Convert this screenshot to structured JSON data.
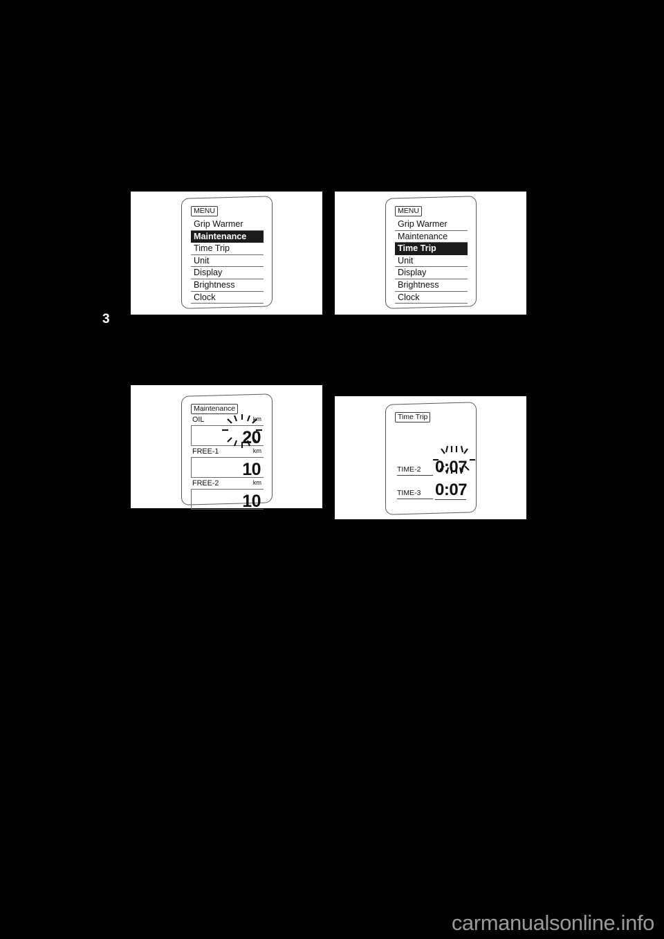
{
  "page": {
    "chapter_marker": "3",
    "background_color": "#000000",
    "plate_color": "#ffffff",
    "watermark": "carmanualsonline.info",
    "watermark_color": "#9a9a9a"
  },
  "figures": [
    {
      "id": "menu-maintenance",
      "screen_title": "MENU",
      "type": "menu",
      "items": [
        {
          "label": "Grip Warmer",
          "selected": false
        },
        {
          "label": "Maintenance",
          "selected": true
        },
        {
          "label": "Time Trip",
          "selected": false
        },
        {
          "label": "Unit",
          "selected": false
        },
        {
          "label": "Display",
          "selected": false
        },
        {
          "label": "Brightness",
          "selected": false
        },
        {
          "label": "Clock",
          "selected": false
        }
      ]
    },
    {
      "id": "menu-timetrip",
      "screen_title": "MENU",
      "type": "menu",
      "items": [
        {
          "label": "Grip Warmer",
          "selected": false
        },
        {
          "label": "Maintenance",
          "selected": false
        },
        {
          "label": "Time Trip",
          "selected": true
        },
        {
          "label": "Unit",
          "selected": false
        },
        {
          "label": "Display",
          "selected": false
        },
        {
          "label": "Brightness",
          "selected": false
        },
        {
          "label": "Clock",
          "selected": false
        }
      ]
    },
    {
      "id": "maintenance-screen",
      "screen_title": "Maintenance",
      "type": "values",
      "rows": [
        {
          "label": "OIL",
          "unit": "km",
          "value": "20",
          "flashing": true
        },
        {
          "label": "FREE-1",
          "unit": "km",
          "value": "10",
          "flashing": false
        },
        {
          "label": "FREE-2",
          "unit": "km",
          "value": "10",
          "flashing": false
        }
      ]
    },
    {
      "id": "timetrip-screen",
      "screen_title": "Time Trip",
      "type": "time",
      "rows": [
        {
          "label": "TIME-2",
          "value": "0:07",
          "flashing": true
        },
        {
          "label": "TIME-3",
          "value": "0:07",
          "flashing": false
        }
      ]
    }
  ]
}
